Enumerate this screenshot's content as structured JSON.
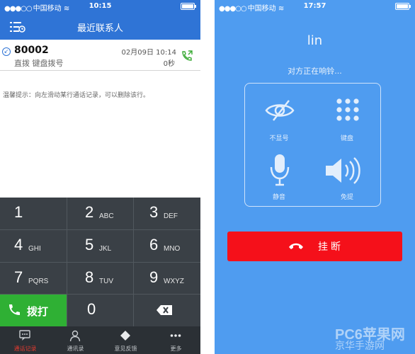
{
  "left": {
    "status": {
      "carrier": "中国移动",
      "time": "10:15"
    },
    "navbar": {
      "title": "最近联系人"
    },
    "call_log": [
      {
        "number": "80002",
        "subtitle": "直拨 键盘拨号",
        "date": "02月09日 10:14",
        "duration": "0秒"
      }
    ],
    "tip": "温馨提示：向左滑动某行通话记录，可以删除该行。",
    "keypad": {
      "keys": [
        {
          "digit": "1",
          "letters": ""
        },
        {
          "digit": "2",
          "letters": "ABC"
        },
        {
          "digit": "3",
          "letters": "DEF"
        },
        {
          "digit": "4",
          "letters": "GHI"
        },
        {
          "digit": "5",
          "letters": "JKL"
        },
        {
          "digit": "6",
          "letters": "MNO"
        },
        {
          "digit": "7",
          "letters": "PQRS"
        },
        {
          "digit": "8",
          "letters": "TUV"
        },
        {
          "digit": "9",
          "letters": "WXYZ"
        }
      ],
      "call_label": "拨打",
      "zero": "0"
    },
    "tabs": [
      {
        "label": "通话记录",
        "icon": "chat-icon",
        "active": true
      },
      {
        "label": "通讯录",
        "icon": "person-icon",
        "active": false
      },
      {
        "label": "意见反馈",
        "icon": "diamond-icon",
        "active": false
      },
      {
        "label": "更多",
        "icon": "more-icon",
        "active": false
      }
    ]
  },
  "right": {
    "status": {
      "carrier": "中国移动",
      "time": "17:57"
    },
    "caller": "lin",
    "ringing": "对方正在响铃...",
    "controls": [
      {
        "label": "不显号",
        "icon": "hide-eye-icon"
      },
      {
        "label": "键盘",
        "icon": "keypad-icon"
      },
      {
        "label": "静音",
        "icon": "microphone-icon"
      },
      {
        "label": "免提",
        "icon": "speaker-icon"
      }
    ],
    "hangup_label": "挂断",
    "watermark": "PC6苹果网",
    "watermark_sub": "京华手游网"
  },
  "colors": {
    "left_header": "#2f74d6",
    "keypad_bg": "#3a4046",
    "call_green": "#2fb034",
    "right_bg": "#4f9cf0",
    "hangup_red": "#f5101a",
    "active_tab": "#e23a2f"
  }
}
